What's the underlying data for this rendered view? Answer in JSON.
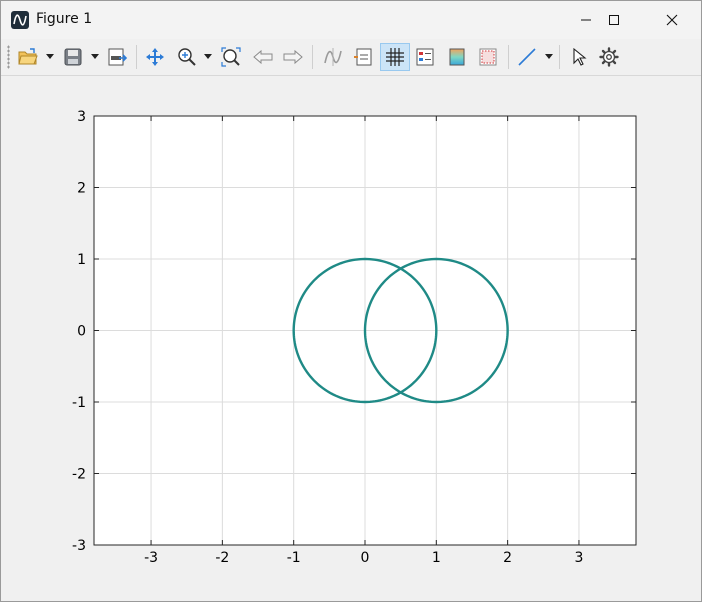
{
  "window": {
    "title": "Figure 1",
    "controls": [
      "minimize",
      "maximize",
      "close"
    ]
  },
  "toolbar": {
    "buttons": [
      {
        "name": "open-icon",
        "has_dropdown": true
      },
      {
        "name": "save-icon",
        "has_dropdown": true
      },
      {
        "name": "export-icon",
        "has_dropdown": false
      },
      {
        "name": "pan-icon",
        "has_dropdown": false
      },
      {
        "name": "zoom-icon",
        "has_dropdown": true
      },
      {
        "name": "zoom-fit-icon",
        "has_dropdown": false
      },
      {
        "name": "back-arrow-icon",
        "has_dropdown": false
      },
      {
        "name": "forward-arrow-icon",
        "has_dropdown": false
      },
      {
        "name": "data-cursor-icon",
        "has_dropdown": false
      },
      {
        "name": "legend-icon",
        "has_dropdown": false
      },
      {
        "name": "grid-icon",
        "has_dropdown": false,
        "active": true
      },
      {
        "name": "properties-icon",
        "has_dropdown": false
      },
      {
        "name": "colorbar-icon",
        "has_dropdown": false
      },
      {
        "name": "axes-box-icon",
        "has_dropdown": false
      },
      {
        "name": "line-style-icon",
        "has_dropdown": true
      },
      {
        "name": "select-pointer-icon",
        "has_dropdown": false
      },
      {
        "name": "settings-gear-icon",
        "has_dropdown": false
      }
    ]
  },
  "chart_data": {
    "type": "line",
    "title": "",
    "xlabel": "",
    "ylabel": "",
    "xlim": [
      -3.8,
      3.8
    ],
    "ylim": [
      -3,
      3
    ],
    "xticks": [
      -3,
      -2,
      -1,
      0,
      1,
      2,
      3
    ],
    "yticks": [
      -3,
      -2,
      -1,
      0,
      1,
      2,
      3
    ],
    "grid": true,
    "legend": "none",
    "series": [
      {
        "shape": "circle",
        "center": [
          0,
          0
        ],
        "radius": 1,
        "color": "#1f8a86"
      },
      {
        "shape": "circle",
        "center": [
          1,
          0
        ],
        "radius": 1,
        "color": "#1f8a86"
      }
    ]
  }
}
